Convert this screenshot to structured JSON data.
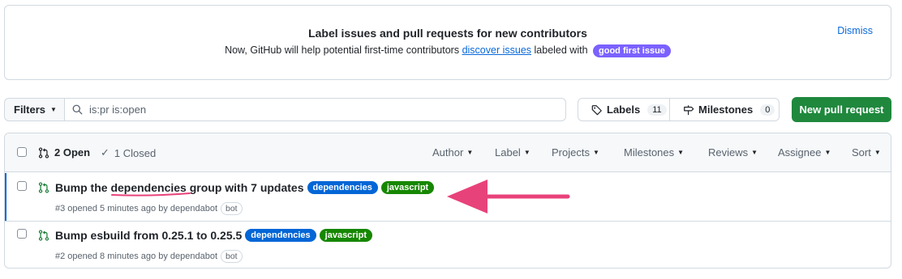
{
  "banner": {
    "title": "Label issues and pull requests for new contributors",
    "desc_prefix": "Now, GitHub will help potential first-time contributors",
    "link_text": "discover issues",
    "desc_mid": "labeled with",
    "badge": "good first issue",
    "dismiss": "Dismiss"
  },
  "toolbar": {
    "filters_label": "Filters",
    "search_value": "is:pr is:open",
    "labels_label": "Labels",
    "labels_count": "11",
    "milestones_label": "Milestones",
    "milestones_count": "0",
    "new_pr_label": "New pull request"
  },
  "list_header": {
    "open_label": "2 Open",
    "closed_label": "1 Closed",
    "sort_items": [
      "Author",
      "Label",
      "Projects",
      "Milestones",
      "Reviews",
      "Assignee",
      "Sort"
    ]
  },
  "pull_requests": [
    {
      "title_prefix": "Bump the",
      "title_highlight": "dependencies",
      "title_suffix": "group with 7 updates",
      "labels": [
        "dependencies",
        "javascript"
      ],
      "meta": "#3 opened 5 minutes ago by dependabot",
      "bot": "bot"
    },
    {
      "title": "Bump esbuild from 0.25.1 to 0.25.5",
      "labels": [
        "dependencies",
        "javascript"
      ],
      "meta": "#2 opened 8 minutes ago by dependabot",
      "bot": "bot"
    }
  ],
  "colors": {
    "label_dependencies": "#0366d6",
    "label_javascript": "#168700",
    "good_first_issue": "#7b61ff",
    "primary_button": "#1f883d",
    "annotation_arrow": "#e8427a",
    "link": "#0969da"
  }
}
